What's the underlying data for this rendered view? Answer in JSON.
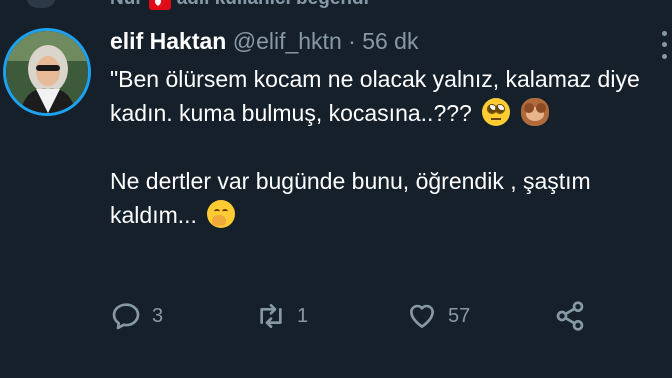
{
  "social_context": {
    "text_start": "Nur",
    "text_end": "adlı kullanıcı beğendi"
  },
  "tweet": {
    "display_name": "elif Haktan",
    "handle": "@elif_hktn",
    "separator": "·",
    "time": "56 dk",
    "paragraph1": "\"Ben ölürsem kocam ne olacak yalnız, kalamaz diye kadın. kuma bulmuş, kocasına..???",
    "paragraph2": "Ne dertler var bugünde bunu, öğrendik , şaştım kaldım..."
  },
  "actions": {
    "reply_count": "3",
    "retweet_count": "1",
    "like_count": "57"
  },
  "icons": {
    "reply": "reply-icon",
    "retweet": "retweet-icon",
    "like": "heart-icon",
    "share": "share-icon",
    "more": "more-vertical-icon",
    "flag": "turkey-flag-icon"
  },
  "colors": {
    "background": "#15202b",
    "secondary_text": "#8899a6",
    "accent": "#1da1f2"
  }
}
